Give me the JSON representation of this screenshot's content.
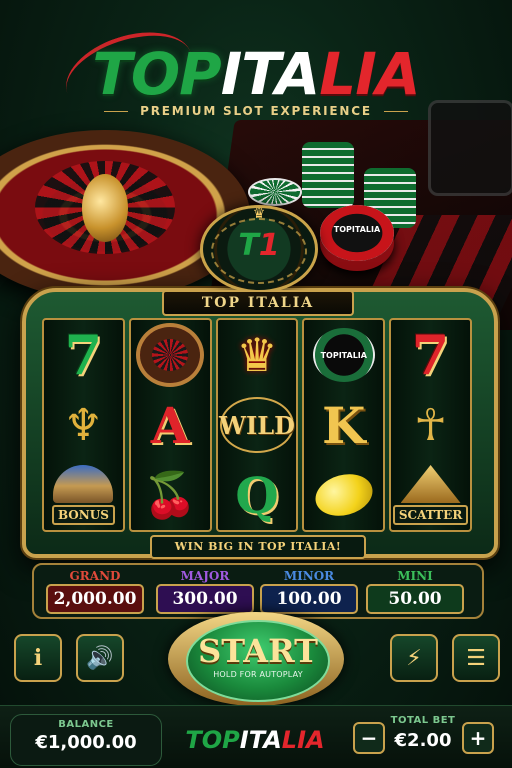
{
  "logo": {
    "part_green": "TOP",
    "part_white": "ITA",
    "part_red": "LIA"
  },
  "tagline": "PREMIUM SLOT EXPERIENCE",
  "emblem": {
    "t1": "T",
    "t2": "1"
  },
  "chip_label": "TOPITALIA",
  "machine": {
    "title": "TOP ITALIA",
    "win_text": "WIN BIG IN TOP ITALIA!"
  },
  "reels": [
    {
      "top": "7",
      "mid": "scarab-icon",
      "bot": "BONUS"
    },
    {
      "top": "roulette-icon",
      "mid": "A",
      "bot": "cherry-icon"
    },
    {
      "top": "crown-icon",
      "mid": "WILD",
      "bot": "Q"
    },
    {
      "top": "TOPITALIA",
      "mid": "K",
      "bot": "lemon-icon"
    },
    {
      "top": "7",
      "mid": "pharaoh-icon",
      "bot": "SCATTER"
    }
  ],
  "jackpots": [
    {
      "label": "GRAND",
      "value": "2,000.00",
      "color": "#e04a3a"
    },
    {
      "label": "MAJOR",
      "value": "300.00",
      "color": "#a05ae0"
    },
    {
      "label": "MINOR",
      "value": "100.00",
      "color": "#4a8ae0"
    },
    {
      "label": "MINI",
      "value": "50.00",
      "color": "#3bbf5a"
    }
  ],
  "controls": {
    "info": "i",
    "start": "START",
    "start_hint": "HOLD FOR AUTOPLAY",
    "icons": [
      "info-icon",
      "sound-icon",
      "turbo-icon",
      "menu-icon"
    ]
  },
  "balance": {
    "label": "BALANCE",
    "value": "€1,000.00"
  },
  "bet": {
    "label": "TOTAL BET",
    "value": "€2.00",
    "minus": "−",
    "plus": "+"
  },
  "footer_logo": {
    "part_green": "TOP",
    "part_white": "ITA",
    "part_red": "LIA"
  }
}
